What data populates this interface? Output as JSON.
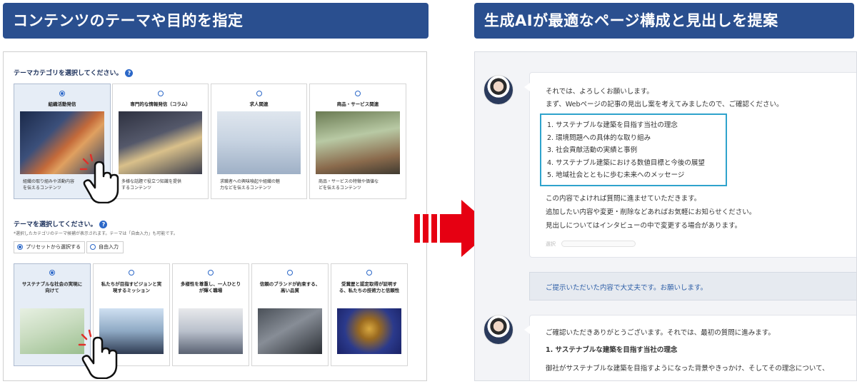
{
  "banners": {
    "left": "コンテンツのテーマや目的を指定",
    "right": "生成AIが最適なページ構成と見出しを提案"
  },
  "form": {
    "category_question": "テーマカテゴリを選択してください。",
    "help": "?",
    "categories": [
      {
        "title": "組織活動発信",
        "desc1": "組織の取り組みや活動内容",
        "desc2": "を伝えるコンテンツ",
        "selected": true
      },
      {
        "title": "専門的な情報発信（コラム）",
        "desc1": "多様な話題で役立つ知識を提供",
        "desc2": "するコンテンツ",
        "selected": false
      },
      {
        "title": "求人関連",
        "desc1": "求職者への興味喚起や組織の魅",
        "desc2": "力などを伝えるコンテンツ",
        "selected": false
      },
      {
        "title": "商品・サービス関連",
        "desc1": "商品・サービスの特徴や価値な",
        "desc2": "どを伝えるコンテンツ",
        "selected": false
      }
    ],
    "theme_question": "テーマを選択してください。",
    "theme_note": "*選択したカテゴリのテーマ候補が表示されます。テーマは「自由入力」も可能です。",
    "mode_preset": "プリセットから選択する",
    "mode_free": "自由入力",
    "themes": [
      {
        "line1": "サステナブルな社会の実現に",
        "line2": "向けて",
        "selected": true
      },
      {
        "line1": "私たちが目指すビジョンと実",
        "line2": "現するミッション",
        "selected": false
      },
      {
        "line1": "多様性を尊重し、一人ひとり",
        "line2": "が輝く職場",
        "selected": false
      },
      {
        "line1": "信頼のブランドが約束する、",
        "line2": "高い品質",
        "selected": false
      },
      {
        "line1": "受賞歴と認定取得が証明す",
        "line2": "る、私たちの技術力と信頼性",
        "selected": false
      }
    ]
  },
  "chat": {
    "ai_intro_1": "それでは、よろしくお願いします。",
    "ai_intro_2": "まず、Webページの記事の見出し案を考えてみましたので、ご確認ください。",
    "outline": [
      "1. サステナブルな建築を目指す当社の理念",
      "2. 環境問題への具体的な取り組み",
      "3. 社会貢献活動の実績と事例",
      "4. サステナブル建築における数値目標と今後の展望",
      "5. 地域社会とともに歩む未来へのメッセージ"
    ],
    "ai_follow_1": "この内容でよければ質問に進ませていただきます。",
    "ai_follow_2": "追加したい内容や変更・削除などあればお気軽にお知らせください。",
    "ai_follow_3": "見出しについてはインタビューの中で変更する場合があります。",
    "select_label": "選択",
    "user_reply": "ご提示いただいた内容で大丈夫です。お願いします。",
    "ai2_line1": "ご確認いただきありがとうございます。それでは、最初の質問に進みます。",
    "ai2_heading": "1. サステナブルな建築を目指す当社の理念",
    "ai2_line2": "御社がサステナブルな建築を目指すようになった背景やきっかけ、そしてその理念について、"
  }
}
